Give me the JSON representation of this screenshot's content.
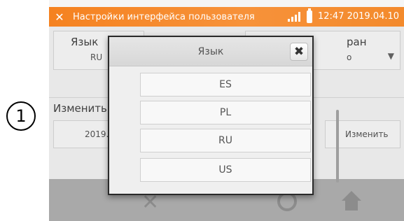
{
  "step_marker": "1",
  "status_bar": {
    "title": "Настройки интерфейса пользователя",
    "datetime": "12:47 2019.04.10",
    "tool_icon": "wrench-screwdriver-icon",
    "signal_icon": "signal-strength-icon",
    "battery_icon": "battery-icon"
  },
  "settings": {
    "language_label": "Язык",
    "language_value": "RU",
    "screen_label_fragment": "ран",
    "screen_value_fragment": "о",
    "change_label": "Изменить",
    "date_value_fragment": "2019.",
    "change_button_label": "Изменить"
  },
  "toolbar": {
    "icons": [
      "settings-tools-icon",
      "help-icon",
      "home-icon"
    ]
  },
  "language_dialog": {
    "title": "Язык",
    "close_icon": "close-icon",
    "options": [
      "ES",
      "PL",
      "RU",
      "US"
    ]
  },
  "colors": {
    "status_bar": "#f58220",
    "toolbar": "#a9a9a9",
    "dialog_border": "#2a2a2a"
  }
}
